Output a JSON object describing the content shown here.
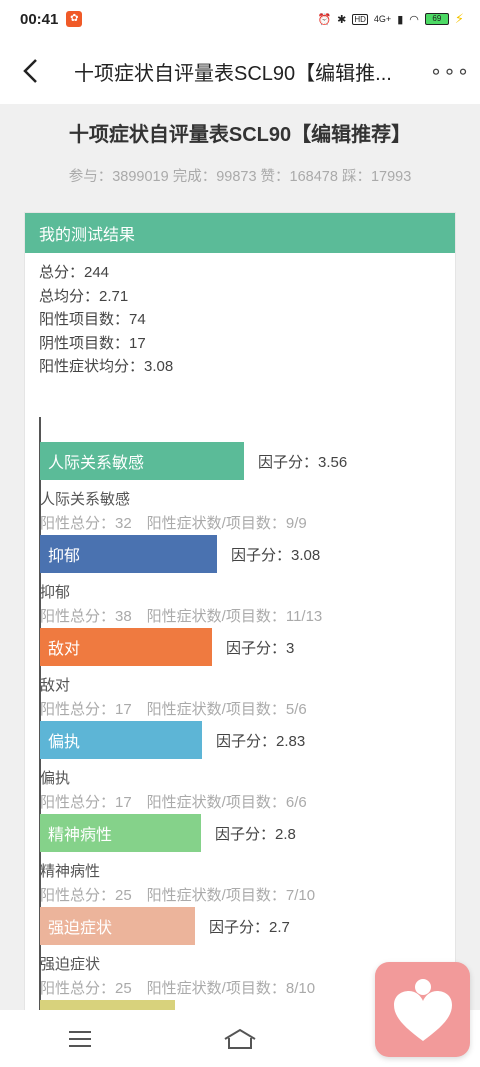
{
  "status_bar": {
    "time": "00:41",
    "network": "4G+",
    "battery": "69"
  },
  "nav": {
    "title": "十项症状自评量表SCL90【编辑推..."
  },
  "page": {
    "heading": "十项症状自评量表SCL90【编辑推荐】",
    "stats": "参与：3899019 完成：99873 赞：168478 踩：17993"
  },
  "result_card": {
    "header": "我的测试结果",
    "summary": [
      "总分：244",
      "总均分：2.71",
      "阳性项目数：74",
      "阴性项目数：17",
      "阳性症状均分：3.08"
    ]
  },
  "colors": {
    "header": "#5bbb98",
    "bar1": "#5bbb98",
    "bar2": "#4a72b0",
    "bar3": "#ef7a40",
    "bar4": "#5db5d6",
    "bar5": "#85d28a",
    "bar6": "#ecb49b",
    "bar7": "#d8d27c"
  },
  "chart_data": {
    "type": "bar",
    "orientation": "horizontal",
    "categories": [
      "人际关系敏感",
      "抑郁",
      "敌对",
      "偏执",
      "精神病性",
      "强迫症状",
      ""
    ],
    "values": [
      3.56,
      3.08,
      3,
      2.83,
      2.8,
      2.7,
      2.35
    ],
    "factor_labels": [
      "因子分：3.56",
      "因子分：3.08",
      "因子分：3",
      "因子分：2.83",
      "因子分：2.8",
      "因子分：2.7",
      ""
    ],
    "names": [
      "人际关系敏感",
      "抑郁",
      "敌对",
      "偏执",
      "精神病性",
      "强迫症状",
      ""
    ],
    "details": [
      "阳性总分：32　阳性症状数/项目数：9/9",
      "阳性总分：38　阳性症状数/项目数：11/13",
      "阳性总分：17　阳性症状数/项目数：5/6",
      "阳性总分：17　阳性症状数/项目数：6/6",
      "阳性总分：25　阳性症状数/项目数：7/10",
      "阳性总分：25　阳性症状数/项目数：8/10",
      ""
    ],
    "colors": [
      "#5bbb98",
      "#4a72b0",
      "#ef7a40",
      "#5db5d6",
      "#85d28a",
      "#ecb49b",
      "#d8d27c"
    ],
    "xlim": [
      0,
      5
    ]
  }
}
